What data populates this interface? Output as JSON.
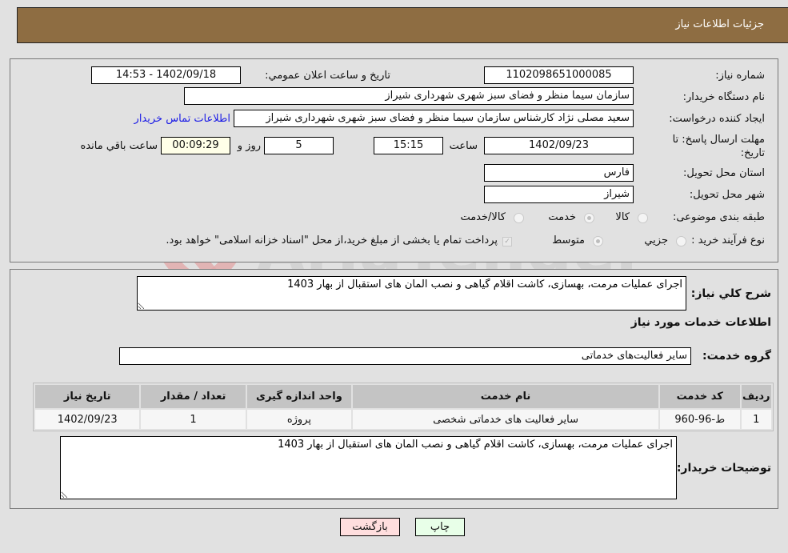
{
  "header": {
    "title": "جزئیات اطلاعات نیاز"
  },
  "form": {
    "need_number": {
      "label": "شماره نیاز:",
      "value": "1102098651000085"
    },
    "announce_datetime": {
      "label": "تاریخ و ساعت اعلان عمومي:",
      "value": "1402/09/18 - 14:53"
    },
    "buyer_org": {
      "label": "نام دستگاه خریدار:",
      "value": "سازمان سیما منظر و فضای سبز شهری شهرداری شیراز"
    },
    "requester": {
      "label": "ایجاد کننده درخواست:",
      "value": "سعید مصلی نژاد کارشناس سازمان سیما منظر و فضای سبز شهری شهرداری شیراز",
      "link": "اطلاعات تماس خریدار"
    },
    "deadline": {
      "label": "مهلت ارسال پاسخ: تا تاریخ:",
      "date": "1402/09/23",
      "time_label": "ساعت",
      "time": "15:15",
      "days": "5",
      "days_label": "روز و",
      "remaining": "00:09:29",
      "remaining_label": "ساعت باقي مانده"
    },
    "province": {
      "label": "استان محل تحویل:",
      "value": "فارس"
    },
    "city": {
      "label": "شهر محل تحویل:",
      "value": "شیراز"
    },
    "category": {
      "label": "طبقه بندی موضوعی:",
      "options": [
        "کالا",
        "خدمت",
        "کالا/خدمت"
      ],
      "selected": "خدمت"
    },
    "purchase_type": {
      "label": "نوع فرآیند خرید :",
      "options": [
        "جزيي",
        "متوسط"
      ],
      "selected": "متوسط",
      "treasury_note": "پرداخت تمام یا بخشی از مبلغ خرید،از محل \"اسناد خزانه اسلامی\" خواهد بود.",
      "treasury_checked": true
    }
  },
  "details": {
    "summary_label": "شرح كلي نیاز:",
    "summary": "اجرای عملیات مرمت، بهسازی، کاشت اقلام گیاهی و نصب المان های استقبال از بهار 1403",
    "services_title": "اطلاعات خدمات مورد نیاز",
    "service_group_label": "گروه خدمت:",
    "service_group": "سایر فعالیت‌های خدماتی",
    "table": {
      "headers": [
        "ردیف",
        "کد خدمت",
        "نام خدمت",
        "واحد اندازه گیری",
        "تعداد / مقدار",
        "تاریخ نیاز"
      ],
      "rows": [
        [
          "1",
          "ط-96-960",
          "سایر فعالیت های خدماتی شخصی",
          "پروژه",
          "1",
          "1402/09/23"
        ]
      ]
    },
    "buyer_notes_label": "توضیحات خریدار:",
    "buyer_notes": "اجرای عملیات مرمت، بهسازی، کاشت اقلام گیاهی و نصب المان های استقبال از بهار 1403"
  },
  "buttons": {
    "print": "چاپ",
    "back": "بازگشت"
  },
  "watermark": {
    "text": "AriaTender.neT"
  },
  "colors": {
    "header_bg": "#8e6d42",
    "link": "#1a1ae6",
    "back_bg": "#ffdede",
    "print_bg": "#e8ffe8",
    "remaining_bg": "#ffffe8"
  }
}
